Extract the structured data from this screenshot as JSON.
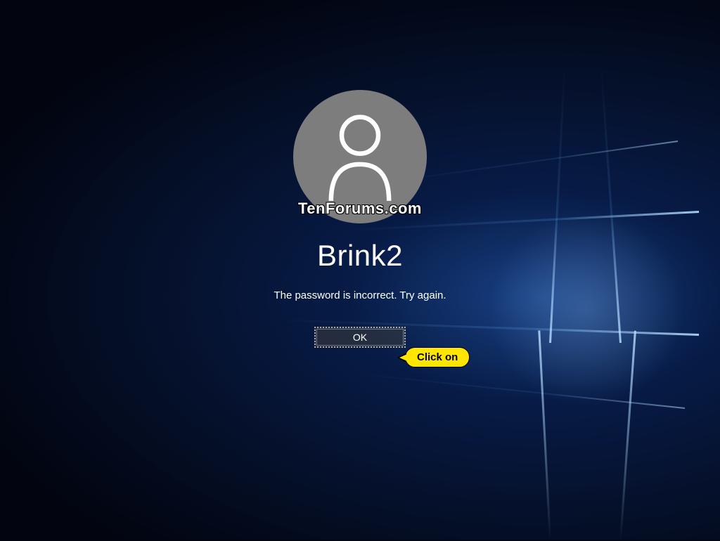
{
  "login": {
    "username": "Brink2",
    "error_message": "The password is incorrect. Try again.",
    "ok_button_label": "OK"
  },
  "watermark": {
    "text": "TenForums.com"
  },
  "annotation": {
    "callout_text": "Click on"
  }
}
